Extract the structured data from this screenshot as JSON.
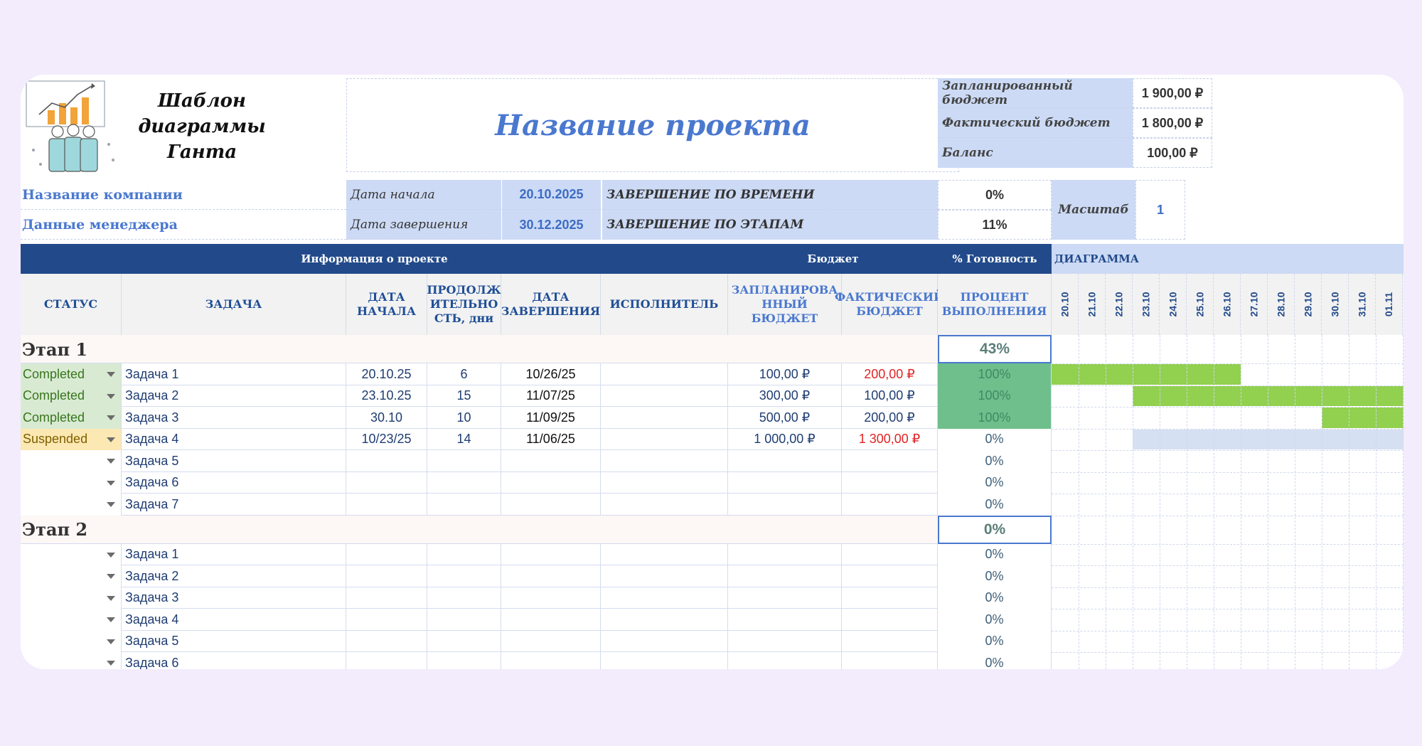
{
  "header": {
    "logo_caption": "Шаблон диаграммы Ганта",
    "project_title": "Название проекта",
    "company_label": "Название компании",
    "manager_label": "Данные менеджера",
    "start_label": "Дата начала",
    "start_value": "20.10.2025",
    "end_label": "Дата завершения",
    "end_value": "30.12.2025",
    "time_completion_label": "ЗАВЕРШЕНИЕ ПО ВРЕМЕНИ",
    "time_completion_value": "0%",
    "stage_completion_label": "ЗАВЕРШЕНИЕ ПО ЭТАПАМ",
    "stage_completion_value": "11%",
    "scale_label": "Масштаб",
    "scale_value": "1"
  },
  "budget": {
    "planned_label": "Запланированный бюджет",
    "planned_value": "1 900,00 ₽",
    "actual_label": "Фактический бюджет",
    "actual_value": "1 800,00 ₽",
    "balance_label": "Баланс",
    "balance_value": "100,00 ₽"
  },
  "group_headers": {
    "project_info": "Информация о проекте",
    "budget": "Бюджет",
    "readiness": "% Готовность",
    "chart": "ДИАГРАММА"
  },
  "columns": {
    "status": "СТАТУС",
    "task": "ЗАДАЧА",
    "start": "ДАТА НАЧАЛА",
    "duration": "ПРОДОЛЖ ИТЕЛЬНО СТЬ, дни",
    "end": "ДАТА ЗАВЕРШЕНИЯ",
    "assignee": "ИСПОЛНИТЕЛЬ",
    "planned_budget": "ЗАПЛАНИРОВА ННЫЙ БЮДЖЕТ",
    "actual_budget": "ФАКТИЧЕСКИЙ БЮДЖЕТ",
    "percent": "ПРОЦЕНТ ВЫПОЛНЕНИЯ"
  },
  "days": [
    "20.10",
    "21.10",
    "22.10",
    "23.10",
    "24.10",
    "25.10",
    "26.10",
    "27.10",
    "28.10",
    "29.10",
    "30.10",
    "31.10",
    "01.11"
  ],
  "stages": [
    {
      "name": "Этап 1",
      "percent": "43%",
      "tasks": [
        {
          "status": "Completed",
          "task": "Задача 1",
          "start": "20.10.25",
          "duration": "6",
          "end": "10/26/25",
          "assignee": "",
          "planned": "100,00 ₽",
          "actual": "200,00 ₽",
          "percent": "100%",
          "gantt_start": 0,
          "gantt_len": 7,
          "bar": "done",
          "over": true
        },
        {
          "status": "Completed",
          "task": "Задача 2",
          "start": "23.10.25",
          "duration": "15",
          "end": "11/07/25",
          "assignee": "",
          "planned": "300,00 ₽",
          "actual": "100,00 ₽",
          "percent": "100%",
          "gantt_start": 3,
          "gantt_len": 15,
          "bar": "done",
          "over": false
        },
        {
          "status": "Completed",
          "task": "Задача 3",
          "start": "30.10",
          "duration": "10",
          "end": "11/09/25",
          "assignee": "",
          "planned": "500,00 ₽",
          "actual": "200,00 ₽",
          "percent": "100%",
          "gantt_start": 10,
          "gantt_len": 10,
          "bar": "done",
          "over": false
        },
        {
          "status": "Suspended",
          "task": "Задача 4",
          "start": "10/23/25",
          "duration": "14",
          "end": "11/06/25",
          "assignee": "",
          "planned": "1 000,00 ₽",
          "actual": "1 300,00 ₽",
          "percent": "0%",
          "gantt_start": 3,
          "gantt_len": 14,
          "bar": "pending",
          "over": true
        },
        {
          "status": "",
          "task": "Задача 5",
          "start": "",
          "duration": "",
          "end": "",
          "assignee": "",
          "planned": "",
          "actual": "",
          "percent": "0%"
        },
        {
          "status": "",
          "task": "Задача 6",
          "start": "",
          "duration": "",
          "end": "",
          "assignee": "",
          "planned": "",
          "actual": "",
          "percent": "0%"
        },
        {
          "status": "",
          "task": "Задача 7",
          "start": "",
          "duration": "",
          "end": "",
          "assignee": "",
          "planned": "",
          "actual": "",
          "percent": "0%"
        }
      ]
    },
    {
      "name": "Этап 2",
      "percent": "0%",
      "tasks": [
        {
          "status": "",
          "task": "Задача 1",
          "start": "",
          "duration": "",
          "end": "",
          "assignee": "",
          "planned": "",
          "actual": "",
          "percent": "0%"
        },
        {
          "status": "",
          "task": "Задача 2",
          "start": "",
          "duration": "",
          "end": "",
          "assignee": "",
          "planned": "",
          "actual": "",
          "percent": "0%"
        },
        {
          "status": "",
          "task": "Задача 3",
          "start": "",
          "duration": "",
          "end": "",
          "assignee": "",
          "planned": "",
          "actual": "",
          "percent": "0%"
        },
        {
          "status": "",
          "task": "Задача 4",
          "start": "",
          "duration": "",
          "end": "",
          "assignee": "",
          "planned": "",
          "actual": "",
          "percent": "0%"
        },
        {
          "status": "",
          "task": "Задача 5",
          "start": "",
          "duration": "",
          "end": "",
          "assignee": "",
          "planned": "",
          "actual": "",
          "percent": "0%"
        },
        {
          "status": "",
          "task": "Задача 6",
          "start": "",
          "duration": "",
          "end": "",
          "assignee": "",
          "planned": "",
          "actual": "",
          "percent": "0%"
        }
      ]
    }
  ],
  "colors": {
    "header_dark": "#224a8b",
    "accent_blue": "#4a78cf",
    "label_bg": "#ccdaf5",
    "completed_bg": "#d9ead3",
    "completed_text": "#38761d",
    "suspended_bg": "#fce8b2",
    "suspended_text": "#7f6000",
    "gantt_done": "#92d050",
    "gantt_pending": "#d5e0f2",
    "percent_done_bg": "#6fbf8c",
    "over_budget": "#e02424"
  }
}
